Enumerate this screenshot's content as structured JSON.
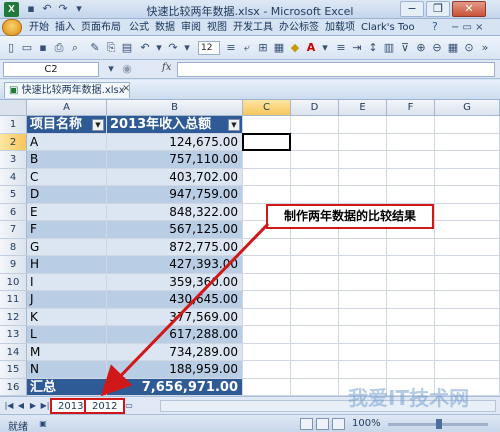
{
  "window": {
    "title": "快速比较两年数据.xlsx - Microsoft Excel",
    "app_icon": "X",
    "controls": {
      "minimize": "−",
      "restore": "❐",
      "close": "✕"
    }
  },
  "ribbon": {
    "tabs": [
      "开始",
      "插入",
      "页面布局",
      "公式",
      "数据",
      "审阅",
      "视图",
      "开发工具",
      "办公标签",
      "加载项",
      "Clark's Too"
    ],
    "help": "?"
  },
  "toolbar": {
    "font_size": "12"
  },
  "formula_bar": {
    "name_box": "C2",
    "fx": "fx",
    "formula": ""
  },
  "workbook": {
    "tab_title": "快速比较两年数据.xlsx",
    "close": "×"
  },
  "grid": {
    "columns": [
      "A",
      "B",
      "C",
      "D",
      "E",
      "F",
      "G"
    ],
    "rows": [
      "1",
      "2",
      "3",
      "4",
      "5",
      "6",
      "7",
      "8",
      "9",
      "10",
      "11",
      "12",
      "13",
      "14",
      "15",
      "16"
    ],
    "header": {
      "col_a": "项目名称",
      "col_b": "2013年收入总额"
    },
    "data": [
      {
        "name": "A",
        "value": "124,675.00"
      },
      {
        "name": "B",
        "value": "757,110.00"
      },
      {
        "name": "C",
        "value": "403,702.00"
      },
      {
        "name": "D",
        "value": "947,759.00"
      },
      {
        "name": "E",
        "value": "848,322.00"
      },
      {
        "name": "F",
        "value": "567,125.00"
      },
      {
        "name": "G",
        "value": "872,775.00"
      },
      {
        "name": "H",
        "value": "427,393.00"
      },
      {
        "name": "I",
        "value": "359,360.00"
      },
      {
        "name": "J",
        "value": "430,645.00"
      },
      {
        "name": "K",
        "value": "377,569.00"
      },
      {
        "name": "L",
        "value": "617,288.00"
      },
      {
        "name": "M",
        "value": "734,289.00"
      },
      {
        "name": "N",
        "value": "188,959.00"
      }
    ],
    "total": {
      "name": "汇总",
      "value": "7,656,971.00"
    },
    "selected_cell": "C2"
  },
  "annotation": {
    "text": "制作两年数据的比较结果",
    "color": "#d01818"
  },
  "sheets": [
    "2013",
    "2012"
  ],
  "status": {
    "ready": "就绪",
    "zoom": "100%"
  },
  "watermark": "我爱IT技术网"
}
